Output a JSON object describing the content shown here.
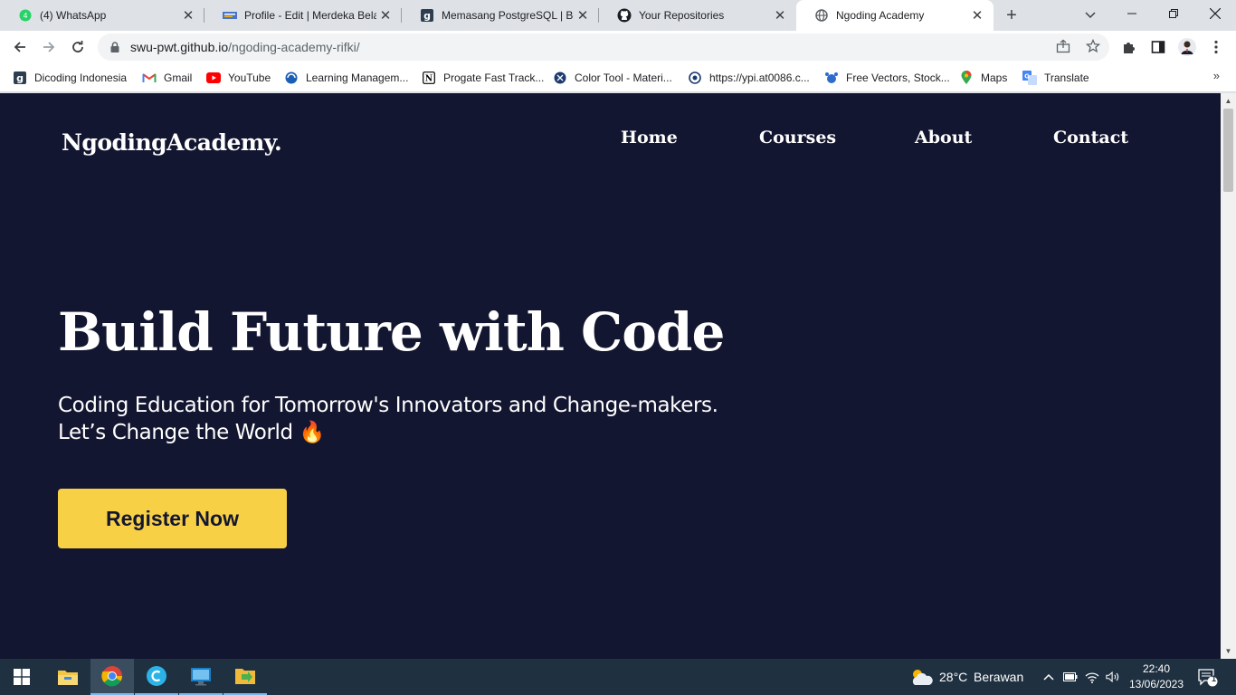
{
  "browser": {
    "tabs": [
      {
        "title": "(4) WhatsApp",
        "icon": "whatsapp-icon",
        "active": false
      },
      {
        "title": "Profile - Edit | Merdeka Belaja",
        "icon": "kampus-merdeka-icon",
        "active": false
      },
      {
        "title": "Memasang PostgreSQL | Bela",
        "icon": "dicoding-icon",
        "active": false
      },
      {
        "title": "Your Repositories",
        "icon": "github-icon",
        "active": false
      },
      {
        "title": "Ngoding Academy",
        "icon": "globe-icon",
        "active": true
      }
    ],
    "address": {
      "host": "swu-pwt.github.io",
      "path": "/ngoding-academy-rifki/"
    },
    "bookmarks": [
      {
        "label": "Dicoding Indonesia",
        "icon": "dicoding-icon"
      },
      {
        "label": "Gmail",
        "icon": "gmail-icon"
      },
      {
        "label": "YouTube",
        "icon": "youtube-icon"
      },
      {
        "label": "Learning Managem...",
        "icon": "lms-icon"
      },
      {
        "label": "Progate Fast Track...",
        "icon": "notion-icon"
      },
      {
        "label": "Color Tool - Materi...",
        "icon": "material-icon"
      },
      {
        "label": "https://ypi.at0086.c...",
        "icon": "link-icon"
      },
      {
        "label": "Free Vectors, Stock...",
        "icon": "freepik-icon"
      },
      {
        "label": "Maps",
        "icon": "maps-icon"
      },
      {
        "label": "Translate",
        "icon": "translate-icon"
      }
    ],
    "bookmarks_overflow": "»"
  },
  "page": {
    "brand": "NgodingAcademy.",
    "nav": [
      "Home",
      "Courses",
      "About",
      "Contact"
    ],
    "hero_title": "Build Future with Code",
    "hero_sub_line1": "Coding Education for Tomorrow's Innovators and Change-makers.",
    "hero_sub_line2": "Let’s Change the World 🔥",
    "cta": "Register Now",
    "colors": {
      "background": "#131630",
      "accent": "#f7d046",
      "text": "#ffffff"
    }
  },
  "taskbar": {
    "weather_temp": "28°C",
    "weather_desc": "Berawan",
    "time": "22:40",
    "date": "13/06/2023",
    "notification_count": "1"
  }
}
